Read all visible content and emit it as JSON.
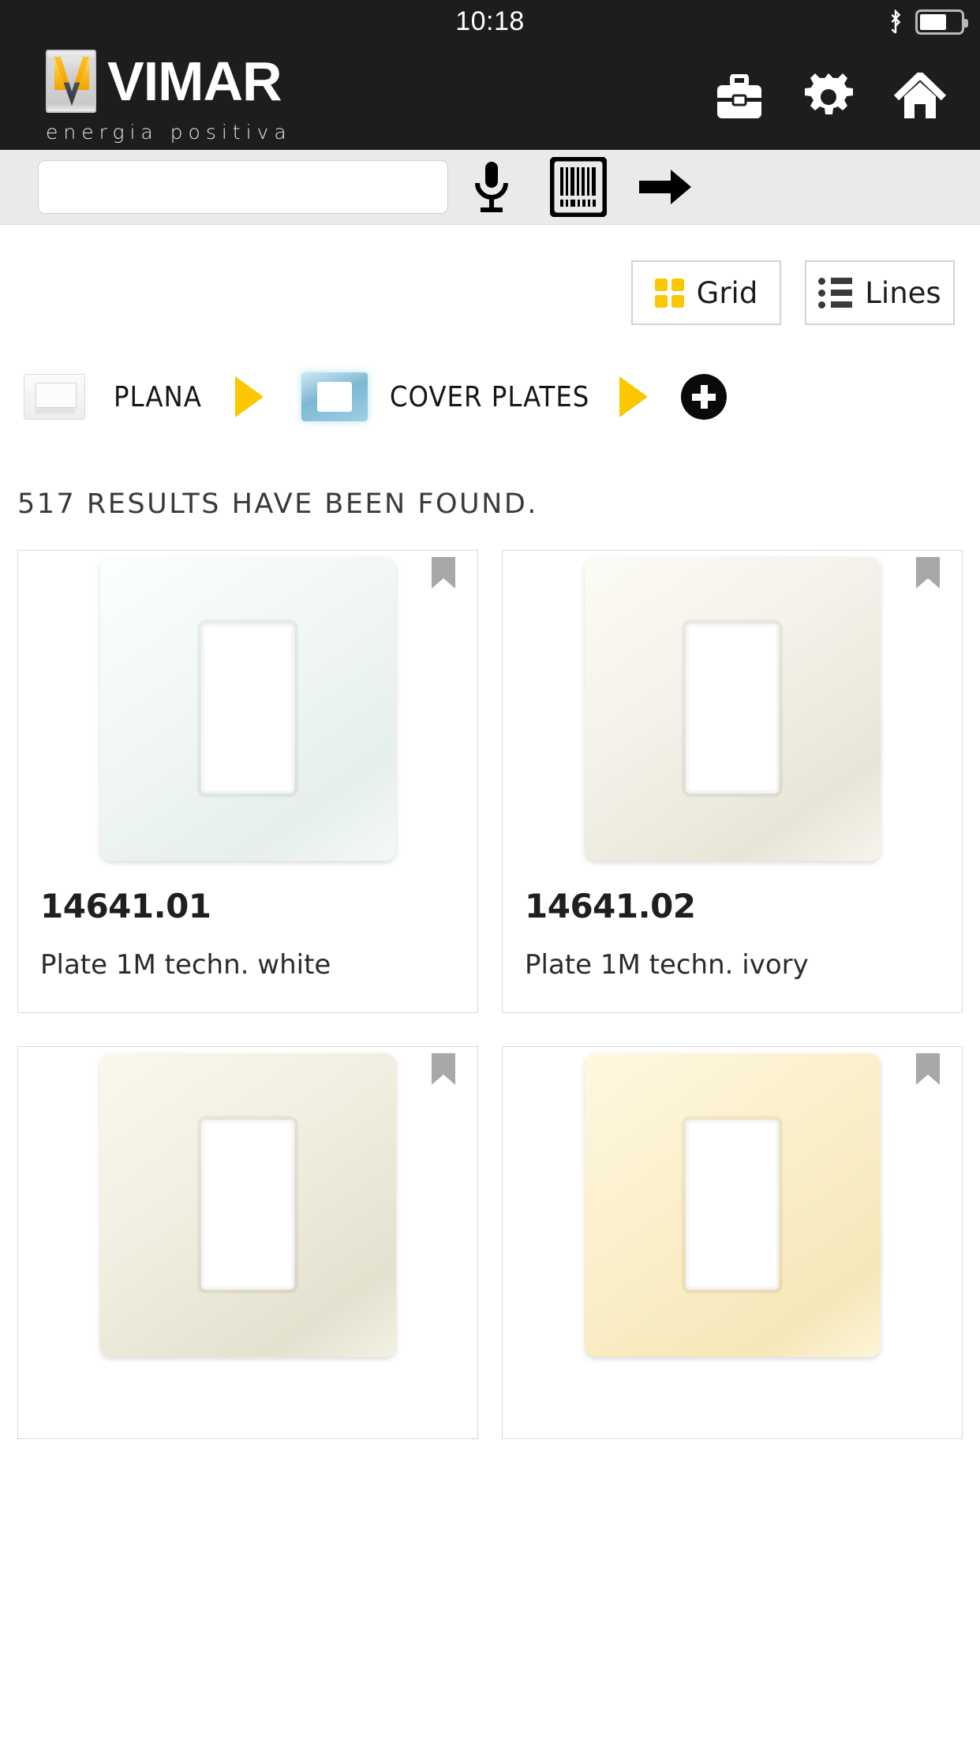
{
  "status_bar": {
    "time": "10:18",
    "bluetooth_icon": "bluetooth-icon",
    "battery_icon": "battery-icon",
    "battery_level": 66
  },
  "header": {
    "brand_name": "VIMAR",
    "brand_tagline": "energia positiva",
    "actions": [
      {
        "name": "briefcase-icon",
        "label": "Briefcase"
      },
      {
        "name": "gear-icon",
        "label": "Settings"
      },
      {
        "name": "home-icon",
        "label": "Home"
      }
    ]
  },
  "search": {
    "value": "",
    "placeholder": "",
    "mic_icon": "microphone-icon",
    "barcode_icon": "barcode-scanner-icon",
    "submit_icon": "arrow-right-icon"
  },
  "view_toggle": {
    "grid_label": "Grid",
    "lines_label": "Lines",
    "active": "Grid",
    "accent_color": "#fbc700"
  },
  "breadcrumb": {
    "items": [
      {
        "label": "PLANA",
        "thumb": "plana-thumb"
      },
      {
        "label": "COVER PLATES",
        "thumb": "cover-plates-thumb"
      }
    ],
    "separator_icon": "triangle-right-icon",
    "add_icon": "plus-circle-icon"
  },
  "results": {
    "count_text": "517 RESULTS HAVE BEEN FOUND.",
    "count": 517
  },
  "products": [
    {
      "code": "14641.01",
      "description": "Plate 1M techn. white",
      "bookmark_icon": "bookmark-icon",
      "plate_color": "#f6fbfa",
      "plate_color_2": "#e4ecea"
    },
    {
      "code": "14641.02",
      "description": "Plate 1M techn. ivory",
      "bookmark_icon": "bookmark-icon",
      "plate_color": "#f7f6ee",
      "plate_color_2": "#e7e5d6"
    },
    {
      "code": "",
      "description": "",
      "bookmark_icon": "bookmark-icon",
      "plate_color": "#f4f2e6",
      "plate_color_2": "#e6e3d2"
    },
    {
      "code": "",
      "description": "",
      "bookmark_icon": "bookmark-icon",
      "plate_color": "#fdf3d5",
      "plate_color_2": "#f7e9bf"
    }
  ]
}
